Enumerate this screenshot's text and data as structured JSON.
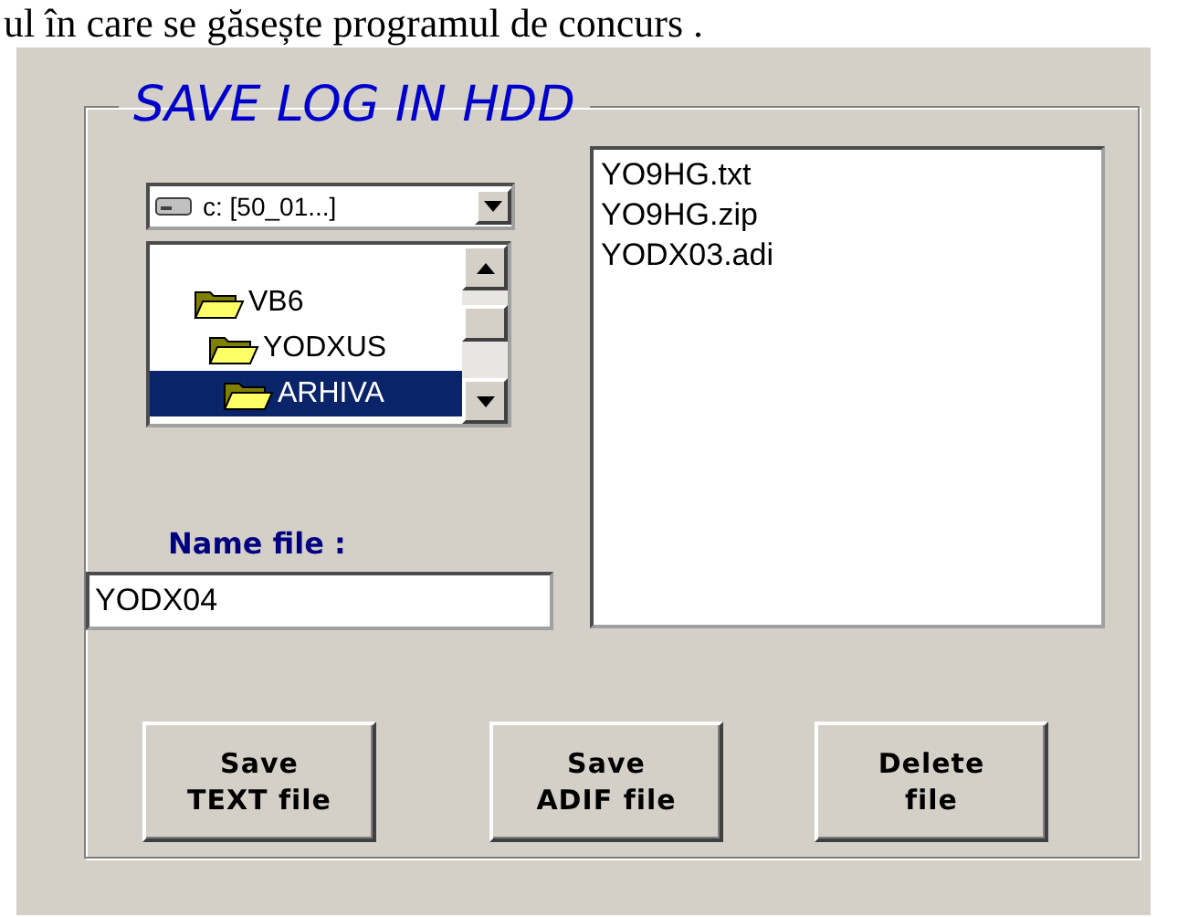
{
  "caption": "ul în care se găsește programul de concurs .",
  "group": {
    "title": "SAVE LOG IN HDD"
  },
  "drive": {
    "value": "c: [50_01...]"
  },
  "folders": [
    {
      "name": "VB6",
      "selected": false,
      "children": [
        {
          "name": "YODXUS",
          "selected": false,
          "children": [
            {
              "name": "ARHIVA",
              "selected": true
            }
          ]
        }
      ]
    }
  ],
  "name_file": {
    "label": "Name file :",
    "value": "YODX04"
  },
  "files": [
    {
      "name": "YO9HG.txt",
      "selected": false
    },
    {
      "name": "YO9HG.zip",
      "selected": false
    },
    {
      "name": "YODX03.adi",
      "selected": false
    }
  ],
  "buttons": [
    {
      "lines": [
        "Save",
        "TEXT file"
      ]
    },
    {
      "lines": [
        "Save",
        "ADIF file"
      ]
    },
    {
      "lines": [
        "Delete",
        "file"
      ]
    }
  ]
}
